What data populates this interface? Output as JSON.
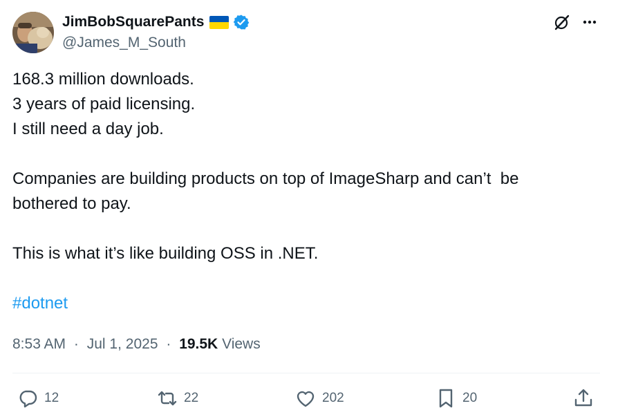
{
  "author": {
    "display_name": "JimBobSquarePants",
    "handle": "@James_M_South",
    "flag_icon": "ukraine-flag-icon",
    "verified_icon": "verified-badge-icon",
    "verified_color": "#1d9bf0"
  },
  "tweet": {
    "lines": [
      "168.3 million downloads.",
      "3 years of paid licensing.",
      "I still need a day job.",
      "Companies are building products on top of ImageSharp and can’t  be",
      "bothered to pay.",
      "This is what it’s like building OSS in .NET."
    ],
    "hashtag": "#dotnet"
  },
  "meta": {
    "time": "8:53 AM",
    "date": "Jul 1, 2025",
    "separator": "·",
    "views_count": "19.5K",
    "views_label": "Views"
  },
  "actions": {
    "replies": "12",
    "reposts": "22",
    "likes": "202",
    "bookmarks": "20"
  },
  "colors": {
    "text": "#0f1419",
    "secondary": "#536471",
    "link": "#1d9bf0",
    "divider": "#eff3f4"
  }
}
